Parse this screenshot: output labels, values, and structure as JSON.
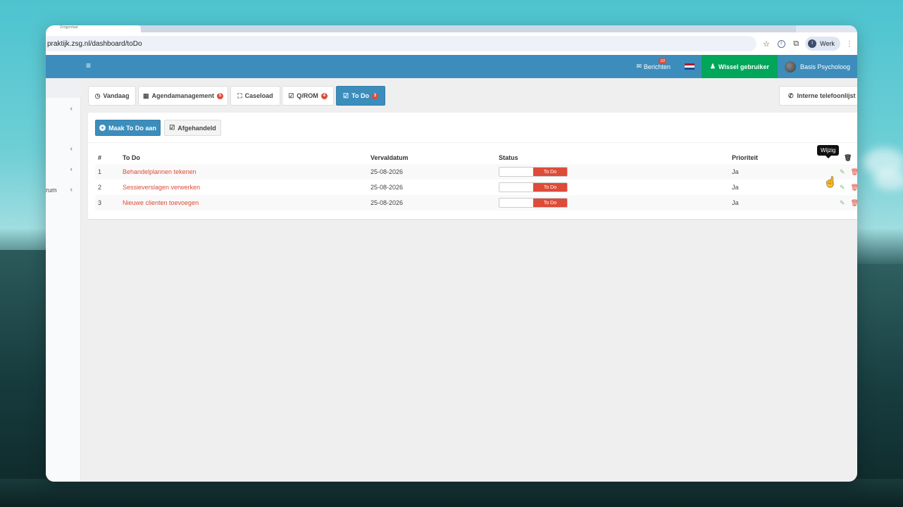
{
  "browser": {
    "tab_title": "Zorgportaal",
    "url": "praktijk.zsg.nl/dashboard/toDo",
    "profile_label": "Werk",
    "profile_initial": "I"
  },
  "topnav": {
    "messages_label": "Berichten",
    "messages_badge": "10!",
    "switch_user_label": "Wissel gebruiker",
    "user_label": "Basis Psycholoog"
  },
  "sidebar": {
    "items": [
      {
        "label": ""
      },
      {
        "label": ""
      },
      {
        "label": ""
      },
      {
        "label": "rum"
      }
    ]
  },
  "tabs": [
    {
      "label": "Vandaag",
      "icon": "clock-icon",
      "count": ""
    },
    {
      "label": "Agendamanagement",
      "icon": "calendar-icon",
      "count": "5"
    },
    {
      "label": "Caseload",
      "icon": "caseload-icon",
      "count": ""
    },
    {
      "label": "Q/ROM",
      "icon": "check-square-icon",
      "count": "4"
    },
    {
      "label": "To Do",
      "icon": "check-square-icon",
      "count": "3"
    }
  ],
  "phone_list_label": "Interne telefoonlijst",
  "actions": {
    "create_label": "Maak To Do aan",
    "done_label": "Afgehandeld"
  },
  "table": {
    "headers": [
      "#",
      "To Do",
      "Vervaldatum",
      "Status",
      "Prioriteit",
      ""
    ],
    "rows": [
      {
        "num": "1",
        "todo": "Behandelplannen tekenen",
        "due": "25-08-2026",
        "status": "To Do",
        "priority": "Ja"
      },
      {
        "num": "2",
        "todo": "Sessieverslagen verwerken",
        "due": "25-08-2026",
        "status": "To Do",
        "priority": "Ja"
      },
      {
        "num": "3",
        "todo": "Nieuwe clienten toevoegen",
        "due": "25-08-2026",
        "status": "To Do",
        "priority": "Ja"
      }
    ]
  },
  "tooltip_text": "Wijzig",
  "colors": {
    "primary": "#3c8dbc",
    "success": "#00a65a",
    "danger": "#dd4b39"
  }
}
